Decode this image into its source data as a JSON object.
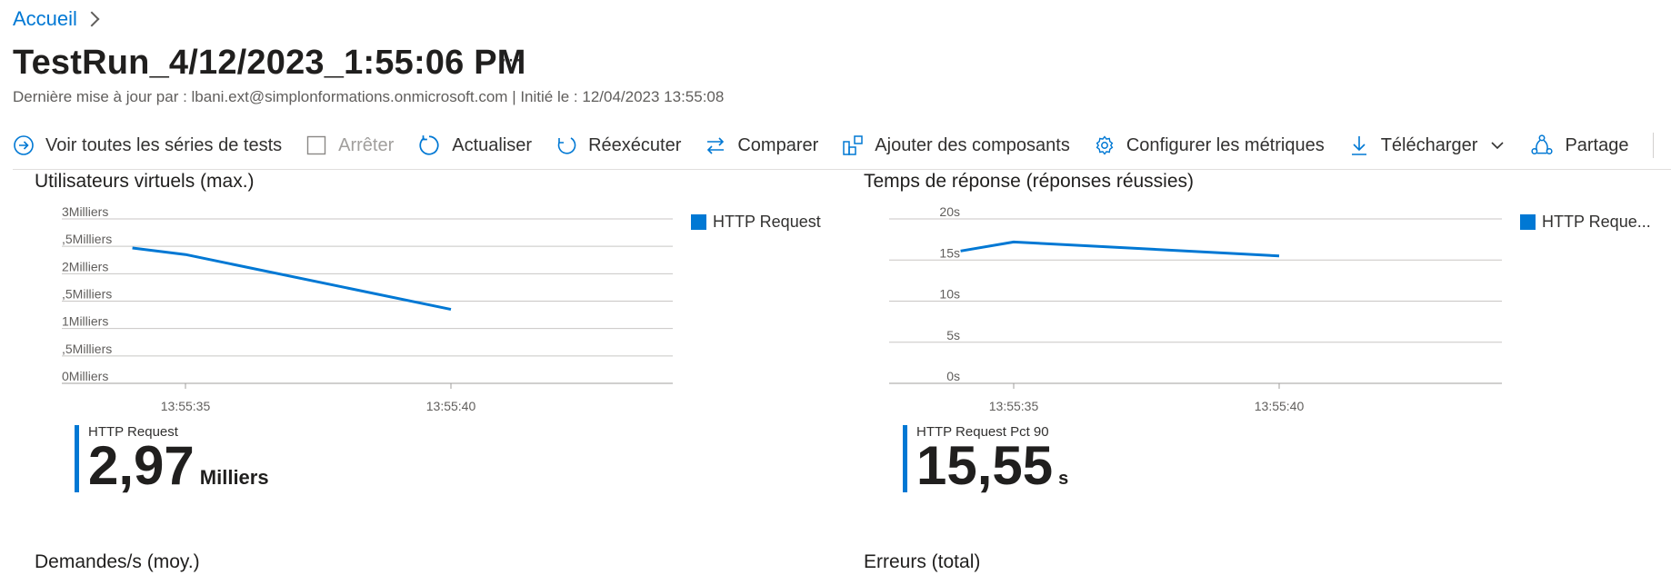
{
  "breadcrumb": {
    "home": "Accueil"
  },
  "header": {
    "title": "TestRun_4/12/2023_1:55:06 PM",
    "more": "···",
    "subtitle": "Dernière mise à jour par : lbani.ext@simplonformations.onmicrosoft.com | Initié le : 12/04/2023 13:55:08"
  },
  "toolbar": {
    "view_all": "Voir toutes les séries de tests",
    "stop": "Arrêter",
    "refresh": "Actualiser",
    "rerun": "Réexécuter",
    "compare": "Comparer",
    "add_components": "Ajouter des composants",
    "configure_metrics": "Configurer les métriques",
    "download": "Télécharger",
    "share": "Partage",
    "more": "···"
  },
  "panels": {
    "virtual_users": {
      "title": "Utilisateurs virtuels (max.)",
      "legend": "HTTP Request",
      "summary_label": "HTTP Request",
      "summary_value": "2,97",
      "summary_unit": "Milliers"
    },
    "response_time": {
      "title": "Temps de réponse (réponses réussies)",
      "legend": "HTTP Reque...",
      "summary_label": "HTTP Request Pct 90",
      "summary_value": "15,55",
      "summary_unit": "s"
    },
    "requests": {
      "title": "Demandes/s (moy.)"
    },
    "errors": {
      "title": "Erreurs (total)"
    }
  },
  "colors": {
    "accent": "#0078d4",
    "text": "#201f1e",
    "muted": "#605e5c",
    "grid": "#c8c6c4"
  },
  "chart_data": [
    {
      "type": "line",
      "title": "Utilisateurs virtuels (max.)",
      "y_ticks": [
        "3Milliers",
        ",5Milliers",
        "2Milliers",
        ",5Milliers",
        "1Milliers",
        ",5Milliers",
        "0Milliers"
      ],
      "x_ticks": [
        "13:55:35",
        "13:55:40"
      ],
      "ylim": [
        0,
        3000
      ],
      "series": [
        {
          "name": "HTTP Request",
          "x": [
            "13:55:34",
            "13:55:35",
            "13:55:40"
          ],
          "values": [
            2470,
            2350,
            1350
          ]
        }
      ]
    },
    {
      "type": "line",
      "title": "Temps de réponse (réponses réussies)",
      "y_ticks": [
        "20s",
        "15s",
        "10s",
        "5s",
        "0s"
      ],
      "x_ticks": [
        "13:55:35",
        "13:55:40"
      ],
      "ylim": [
        0,
        20
      ],
      "series": [
        {
          "name": "HTTP Reque...",
          "x": [
            "13:55:34",
            "13:55:35",
            "13:55:40"
          ],
          "values": [
            16.1,
            17.2,
            15.5
          ]
        }
      ]
    }
  ]
}
